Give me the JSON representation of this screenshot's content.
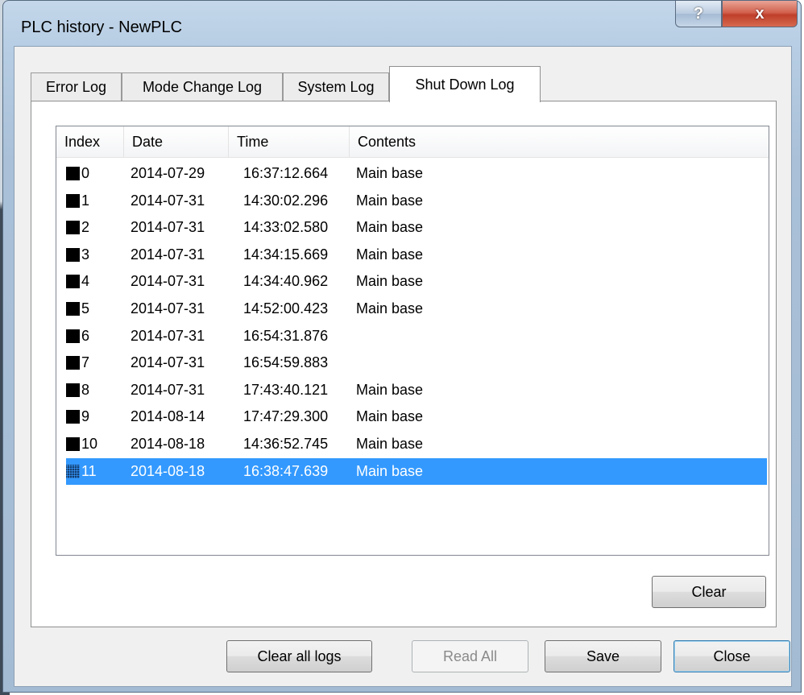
{
  "window": {
    "title": "PLC history - NewPLC"
  },
  "titlebar": {
    "help_label": "?",
    "close_label": "x"
  },
  "tabs": [
    {
      "label": "Error Log",
      "active": false
    },
    {
      "label": "Mode Change Log",
      "active": false
    },
    {
      "label": "System Log",
      "active": false
    },
    {
      "label": "Shut Down Log",
      "active": true
    }
  ],
  "table": {
    "columns": [
      "Index",
      "Date",
      "Time",
      "Contents"
    ],
    "rows": [
      {
        "index": "0",
        "date": "2014-07-29",
        "time": "16:37:12.664",
        "contents": "Main base"
      },
      {
        "index": "1",
        "date": "2014-07-31",
        "time": "14:30:02.296",
        "contents": "Main base"
      },
      {
        "index": "2",
        "date": "2014-07-31",
        "time": "14:33:02.580",
        "contents": "Main base"
      },
      {
        "index": "3",
        "date": "2014-07-31",
        "time": "14:34:15.669",
        "contents": "Main base"
      },
      {
        "index": "4",
        "date": "2014-07-31",
        "time": "14:34:40.962",
        "contents": "Main base"
      },
      {
        "index": "5",
        "date": "2014-07-31",
        "time": "14:52:00.423",
        "contents": "Main base"
      },
      {
        "index": "6",
        "date": "2014-07-31",
        "time": "16:54:31.876",
        "contents": ""
      },
      {
        "index": "7",
        "date": "2014-07-31",
        "time": "16:54:59.883",
        "contents": ""
      },
      {
        "index": "8",
        "date": "2014-07-31",
        "time": "17:43:40.121",
        "contents": "Main base"
      },
      {
        "index": "9",
        "date": "2014-08-14",
        "time": "17:47:29.300",
        "contents": "Main base"
      },
      {
        "index": "10",
        "date": "2014-08-18",
        "time": "14:36:52.745",
        "contents": "Main base"
      },
      {
        "index": "11",
        "date": "2014-08-18",
        "time": "16:38:47.639",
        "contents": "Main base",
        "selected": true
      }
    ]
  },
  "panel": {
    "clear_label": "Clear"
  },
  "footer": {
    "clear_all_label": "Clear all logs",
    "read_all_label": "Read All",
    "save_label": "Save",
    "close_label": "Close"
  },
  "colors": {
    "selection": "#3399ff",
    "client_bg": "#f0f0f0",
    "title_bg": "#b6cde3"
  }
}
